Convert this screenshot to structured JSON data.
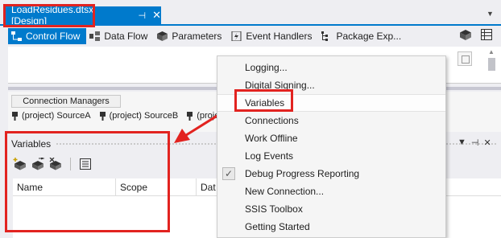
{
  "document_tab": {
    "title": "LoadResidues.dtsx [Design]",
    "pin_glyph": "⊣",
    "close_glyph": "✕"
  },
  "designer_tabs": [
    {
      "label": "Control Flow",
      "icon": "control-flow-icon",
      "active": true
    },
    {
      "label": "Data Flow",
      "icon": "data-flow-icon",
      "active": false
    },
    {
      "label": "Parameters",
      "icon": "parameters-icon",
      "active": false
    },
    {
      "label": "Event Handlers",
      "icon": "event-handlers-icon",
      "active": false
    },
    {
      "label": "Package Exp...",
      "icon": "package-explorer-icon",
      "active": false
    }
  ],
  "connection_managers": {
    "header": "Connection Managers",
    "items": [
      "(project) SourceA",
      "(project) SourceB",
      "(projec"
    ]
  },
  "variables_panel": {
    "title": "Variables",
    "columns": [
      "Name",
      "Scope",
      "Dat"
    ]
  },
  "context_menu": {
    "items": [
      {
        "label": "Logging...",
        "checked": false
      },
      {
        "label": "Digital Signing...",
        "checked": false
      },
      {
        "label": "Variables",
        "checked": false,
        "highlighted": true
      },
      {
        "label": "Connections",
        "checked": false
      },
      {
        "label": "Work Offline",
        "checked": false
      },
      {
        "label": "Log Events",
        "checked": false
      },
      {
        "label": "Debug Progress Reporting",
        "checked": true
      },
      {
        "label": "New Connection...",
        "checked": false
      },
      {
        "label": "SSIS Toolbox",
        "checked": false
      },
      {
        "label": "Getting Started",
        "checked": false
      }
    ]
  },
  "colors": {
    "accent": "#007acc",
    "annotation_red": "#e22320"
  }
}
